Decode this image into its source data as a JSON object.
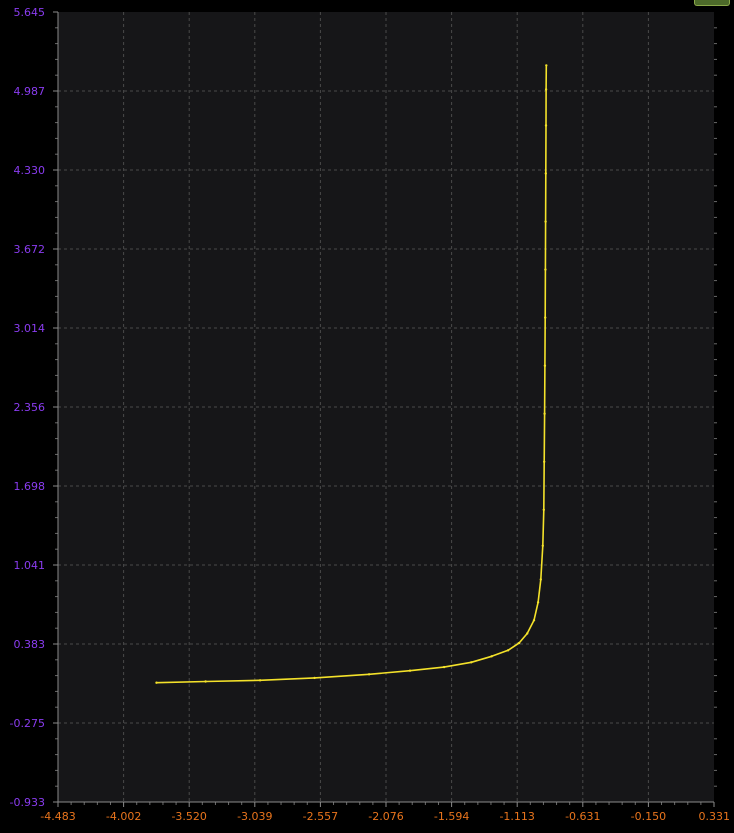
{
  "chart_data": {
    "type": "line",
    "title": "",
    "xlabel": "",
    "ylabel": "",
    "xlim": [
      -4.483,
      0.331
    ],
    "ylim": [
      -0.933,
      5.645
    ],
    "x_ticks": [
      "-4.483",
      "-4.002",
      "-3.520",
      "-3.039",
      "-2.557",
      "-2.076",
      "-1.594",
      "-1.113",
      "-0.631",
      "-0.150",
      "0.331"
    ],
    "y_ticks": [
      "5.645",
      "4.987",
      "4.330",
      "3.672",
      "3.014",
      "2.356",
      "1.698",
      "1.041",
      "0.383",
      "-0.275",
      "-0.933"
    ],
    "grid": true,
    "colors": {
      "background": "#161618",
      "grid": "#4a4a4a",
      "series": "#f4e22a",
      "x_tick": "#e8741c",
      "y_tick": "#8a3cf0"
    },
    "series": [
      {
        "x": [
          -3.76,
          -3.4,
          -3.0,
          -2.6,
          -2.2,
          -1.9,
          -1.65,
          -1.45,
          -1.3,
          -1.18,
          -1.1,
          -1.04,
          -0.99,
          -0.96,
          -0.94,
          -0.925,
          -0.918,
          -0.915,
          -0.912,
          -0.91,
          -0.908,
          -0.906,
          -0.905,
          -0.903,
          -0.902,
          -0.901,
          -0.9
        ],
        "y": [
          0.06,
          0.07,
          0.08,
          0.1,
          0.13,
          0.16,
          0.19,
          0.23,
          0.28,
          0.33,
          0.39,
          0.47,
          0.58,
          0.73,
          0.92,
          1.2,
          1.5,
          1.9,
          2.3,
          2.7,
          3.1,
          3.5,
          3.9,
          4.3,
          4.7,
          5.0,
          5.2
        ]
      }
    ]
  }
}
